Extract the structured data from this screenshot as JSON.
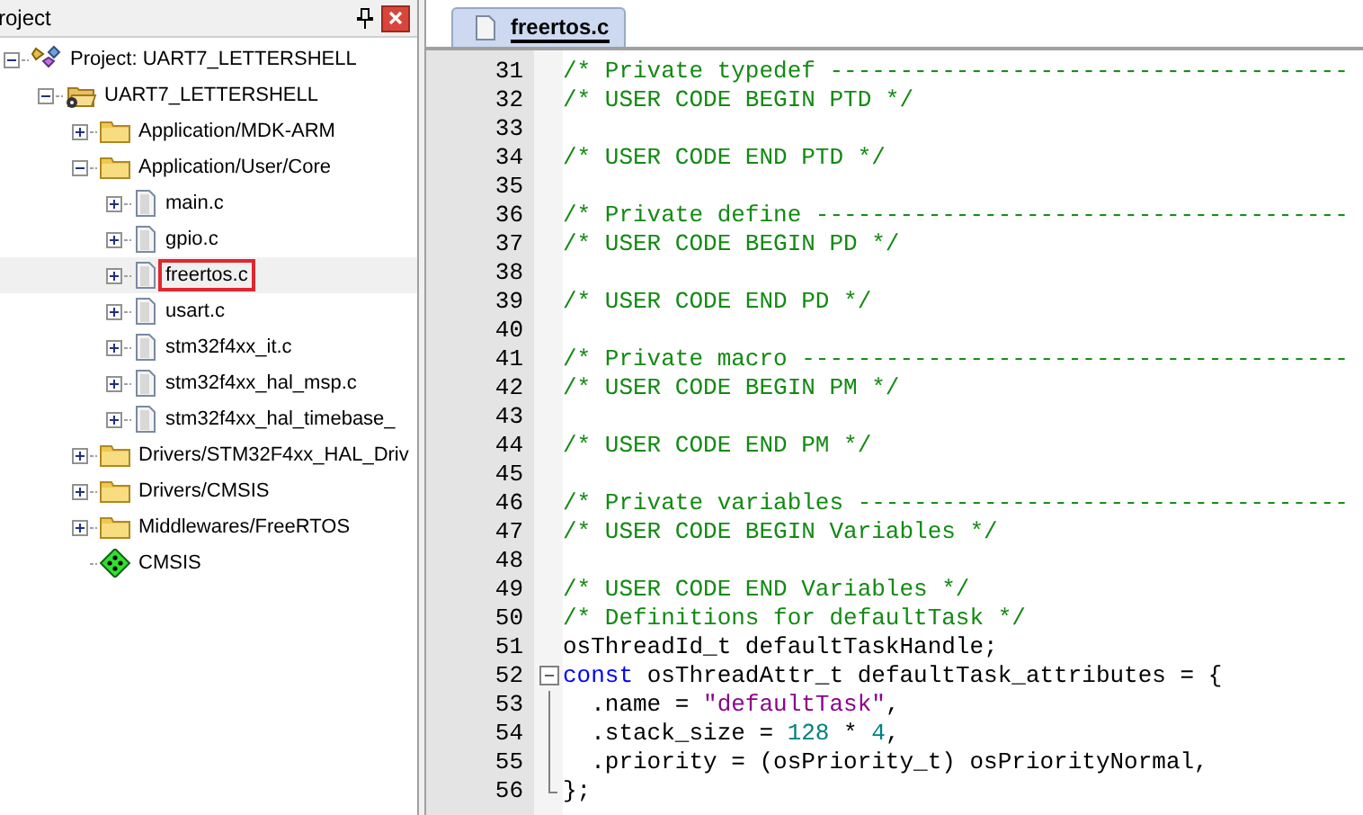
{
  "project_panel": {
    "title": "roject",
    "tree": [
      {
        "label": "Project: UART7_LETTERSHELL",
        "kind": "project",
        "expanded": true,
        "selected": false,
        "children": [
          {
            "label": "UART7_LETTERSHELL",
            "kind": "target",
            "expanded": true,
            "selected": false,
            "children": [
              {
                "label": "Application/MDK-ARM",
                "kind": "folder",
                "expanded": false,
                "selected": false
              },
              {
                "label": "Application/User/Core",
                "kind": "folder",
                "expanded": true,
                "selected": false,
                "children": [
                  {
                    "label": "main.c",
                    "kind": "file",
                    "expanded": false,
                    "selected": false
                  },
                  {
                    "label": "gpio.c",
                    "kind": "file",
                    "expanded": false,
                    "selected": false
                  },
                  {
                    "label": "freertos.c",
                    "kind": "file",
                    "expanded": false,
                    "selected": true
                  },
                  {
                    "label": "usart.c",
                    "kind": "file",
                    "expanded": false,
                    "selected": false
                  },
                  {
                    "label": "stm32f4xx_it.c",
                    "kind": "file",
                    "expanded": false,
                    "selected": false
                  },
                  {
                    "label": "stm32f4xx_hal_msp.c",
                    "kind": "file",
                    "expanded": false,
                    "selected": false
                  },
                  {
                    "label": "stm32f4xx_hal_timebase_",
                    "kind": "file",
                    "expanded": false,
                    "selected": false
                  }
                ]
              },
              {
                "label": "Drivers/STM32F4xx_HAL_Driv",
                "kind": "folder",
                "expanded": false,
                "selected": false
              },
              {
                "label": "Drivers/CMSIS",
                "kind": "folder",
                "expanded": false,
                "selected": false
              },
              {
                "label": "Middlewares/FreeRTOS",
                "kind": "folder",
                "expanded": false,
                "selected": false
              },
              {
                "label": "CMSIS",
                "kind": "component",
                "selected": false
              }
            ]
          }
        ]
      }
    ]
  },
  "editor": {
    "tabs": [
      {
        "label": "freertos.c",
        "selected": true
      }
    ],
    "lines": [
      {
        "number": "31",
        "tokens": [
          {
            "kind": "comment",
            "text": "/* Private typedef -------------------------------------"
          }
        ]
      },
      {
        "number": "32",
        "tokens": [
          {
            "kind": "comment",
            "text": "/* USER CODE BEGIN PTD */"
          }
        ]
      },
      {
        "number": "33"
      },
      {
        "number": "34",
        "tokens": [
          {
            "kind": "comment",
            "text": "/* USER CODE END PTD */"
          }
        ]
      },
      {
        "number": "35"
      },
      {
        "number": "36",
        "tokens": [
          {
            "kind": "comment",
            "text": "/* Private define --------------------------------------"
          }
        ]
      },
      {
        "number": "37",
        "tokens": [
          {
            "kind": "comment",
            "text": "/* USER CODE BEGIN PD */"
          }
        ]
      },
      {
        "number": "38"
      },
      {
        "number": "39",
        "tokens": [
          {
            "kind": "comment",
            "text": "/* USER CODE END PD */"
          }
        ]
      },
      {
        "number": "40"
      },
      {
        "number": "41",
        "tokens": [
          {
            "kind": "comment",
            "text": "/* Private macro ---------------------------------------"
          }
        ]
      },
      {
        "number": "42",
        "tokens": [
          {
            "kind": "comment",
            "text": "/* USER CODE BEGIN PM */"
          }
        ]
      },
      {
        "number": "43"
      },
      {
        "number": "44",
        "tokens": [
          {
            "kind": "comment",
            "text": "/* USER CODE END PM */"
          }
        ]
      },
      {
        "number": "45"
      },
      {
        "number": "46",
        "tokens": [
          {
            "kind": "comment",
            "text": "/* Private variables -----------------------------------"
          }
        ]
      },
      {
        "number": "47",
        "tokens": [
          {
            "kind": "comment",
            "text": "/* USER CODE BEGIN Variables */"
          }
        ]
      },
      {
        "number": "48"
      },
      {
        "number": "49",
        "tokens": [
          {
            "kind": "comment",
            "text": "/* USER CODE END Variables */"
          }
        ]
      },
      {
        "number": "50",
        "tokens": [
          {
            "kind": "comment",
            "text": "/* Definitions for defaultTask */"
          }
        ]
      },
      {
        "number": "51",
        "tokens": [
          {
            "kind": "plain",
            "text": "osThreadId_t defaultTaskHandle;"
          }
        ]
      },
      {
        "number": "52",
        "kind": "fold-start",
        "tokens": [
          {
            "kind": "keyword",
            "text": "const"
          },
          {
            "kind": "plain",
            "text": " osThreadAttr_t defaultTask_attributes = {"
          }
        ]
      },
      {
        "number": "53",
        "kind": "fold-inside",
        "tokens": [
          {
            "kind": "plain",
            "text": "  .name = "
          },
          {
            "kind": "string",
            "text": "\"defaultTask\""
          },
          {
            "kind": "plain",
            "text": ","
          }
        ]
      },
      {
        "number": "54",
        "kind": "fold-inside",
        "tokens": [
          {
            "kind": "plain",
            "text": "  .stack_size = "
          },
          {
            "kind": "number",
            "text": "128"
          },
          {
            "kind": "plain",
            "text": " * "
          },
          {
            "kind": "number",
            "text": "4"
          },
          {
            "kind": "plain",
            "text": ","
          }
        ]
      },
      {
        "number": "55",
        "kind": "fold-inside",
        "tokens": [
          {
            "kind": "plain",
            "text": "  .priority = (osPriority_t) osPriorityNormal,"
          }
        ]
      },
      {
        "number": "56",
        "kind": "fold-end",
        "tokens": [
          {
            "kind": "plain",
            "text": "};"
          }
        ]
      }
    ]
  }
}
